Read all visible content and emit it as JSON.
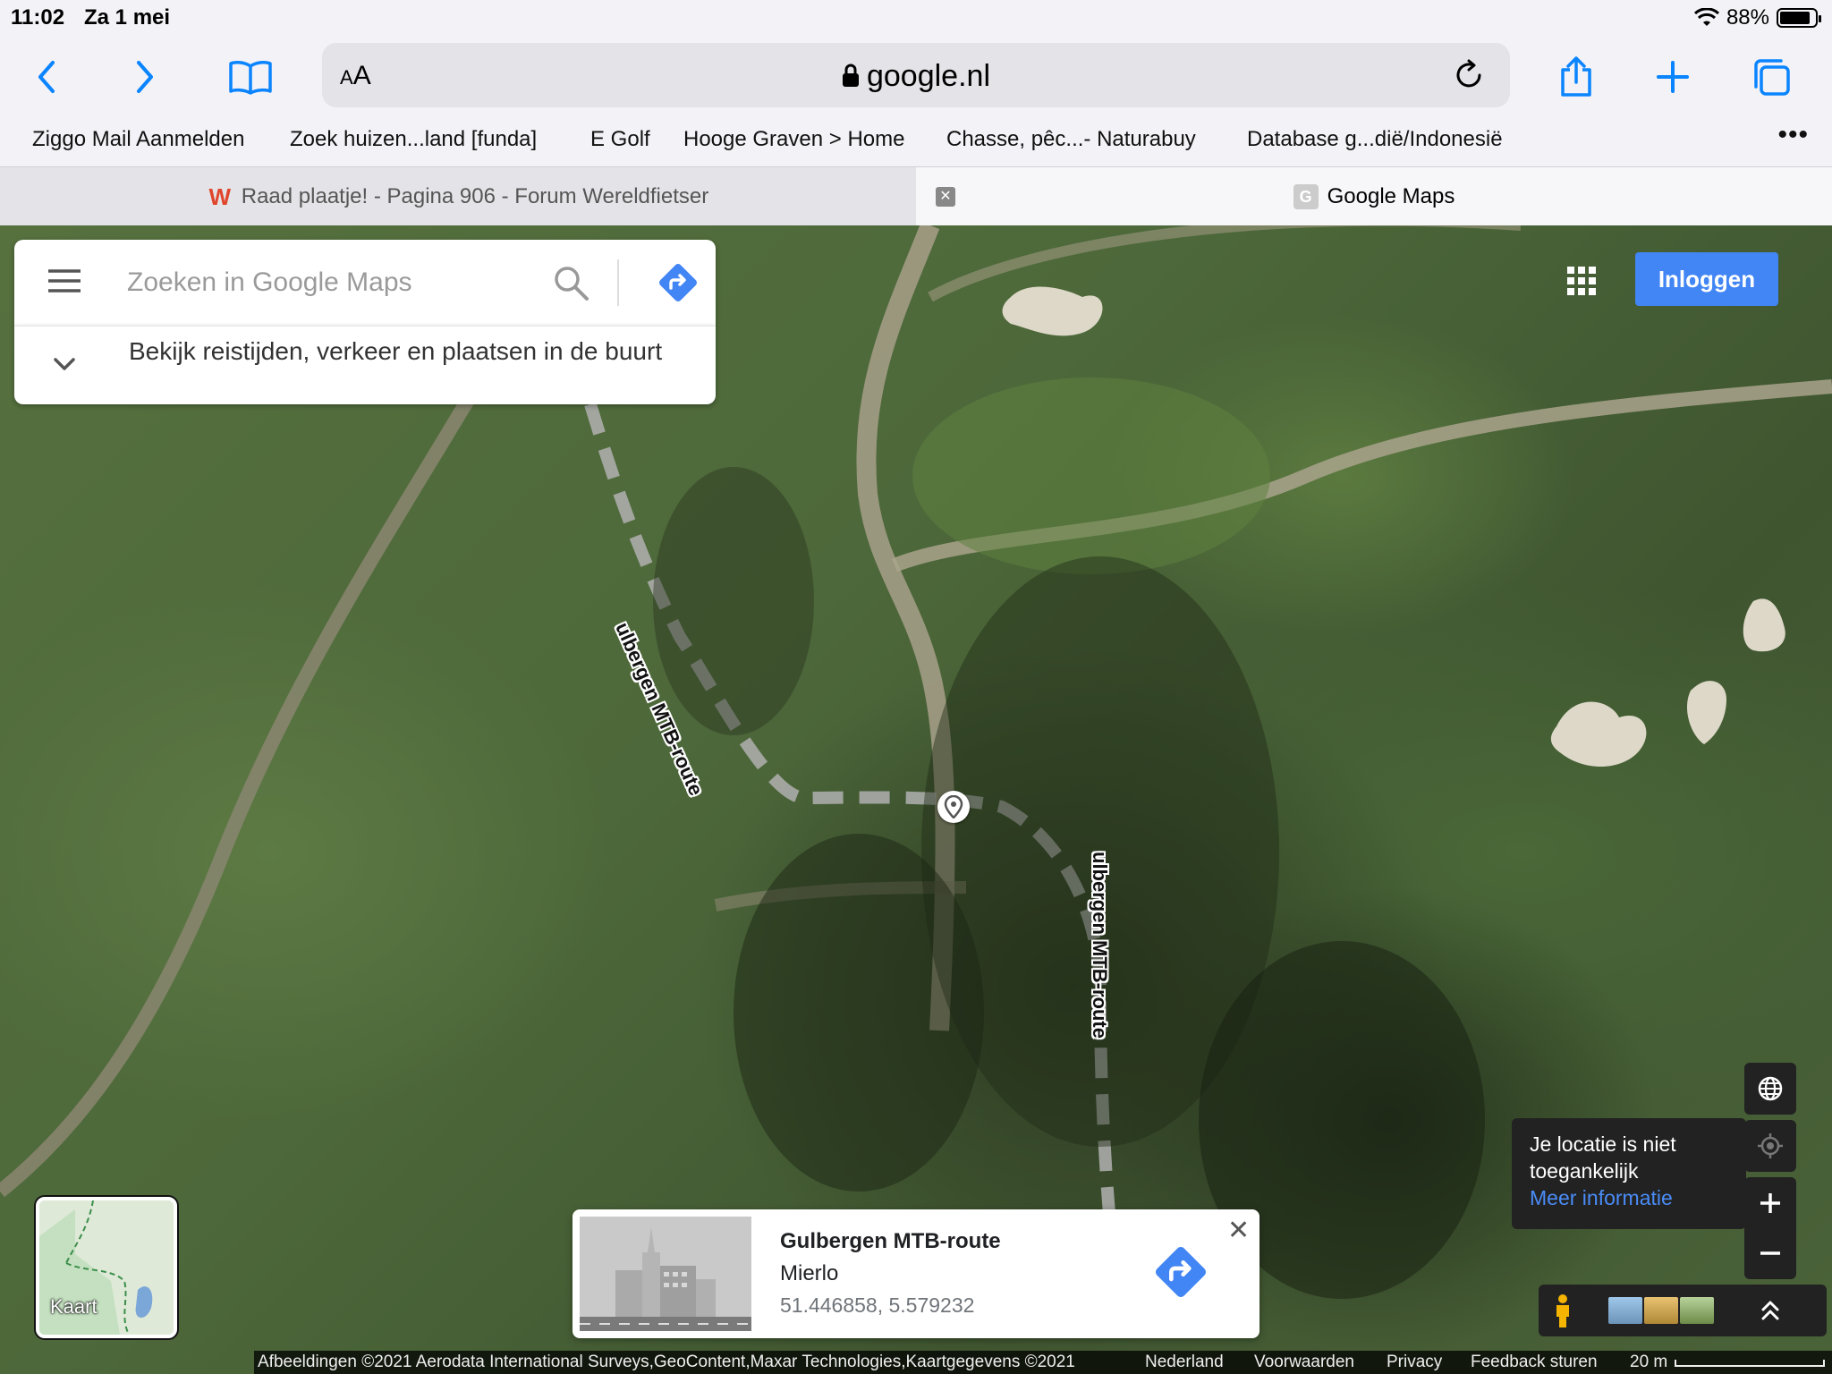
{
  "status_bar": {
    "time": "11:02",
    "date": "Za 1 mei",
    "battery": "88%",
    "battery_level": 0.88
  },
  "toolbar": {
    "text_size_label_small": "A",
    "text_size_label_large": "A",
    "url": "google.nl"
  },
  "bookmarks": [
    "Ziggo Mail Aanmelden",
    "Zoek huizen...land [funda]",
    "E Golf",
    "Hooge Graven > Home",
    "Chasse, pêc...- Naturabuy",
    "Database g...dië/Indonesië"
  ],
  "tabs": [
    {
      "label": "Raad plaatje! - Pagina 906 - Forum Wereldfietser",
      "favicon": "W"
    },
    {
      "label": "Google Maps",
      "favicon": "G"
    }
  ],
  "maps": {
    "search_placeholder": "Zoeken in Google Maps",
    "nearby_text": "Bekijk reistijden, verkeer en plaatsen in de buurt",
    "login_label": "Inloggen",
    "route_labels": [
      "ulbergen MTB-route",
      "ulbergen MTB-route"
    ],
    "location_tip": {
      "text": "Je locatie is niet toegankelijk",
      "link": "Meer informatie"
    },
    "minimap_label": "Kaart"
  },
  "place_card": {
    "title": "Gulbergen MTB-route",
    "locality": "Mierlo",
    "coordinates": "51.446858, 5.579232"
  },
  "footer": {
    "imagery": "Afbeeldingen ©2021 Aerodata International Surveys,GeoContent,Maxar Technologies,Kaartgegevens ©2021",
    "country": "Nederland",
    "terms": "Voorwaarden",
    "privacy": "Privacy",
    "feedback": "Feedback sturen",
    "scale": "20 m"
  },
  "colors": {
    "accent_blue": "#4285f4",
    "safari_blue": "#0a84ff",
    "link_blue": "#4a8cf7"
  }
}
